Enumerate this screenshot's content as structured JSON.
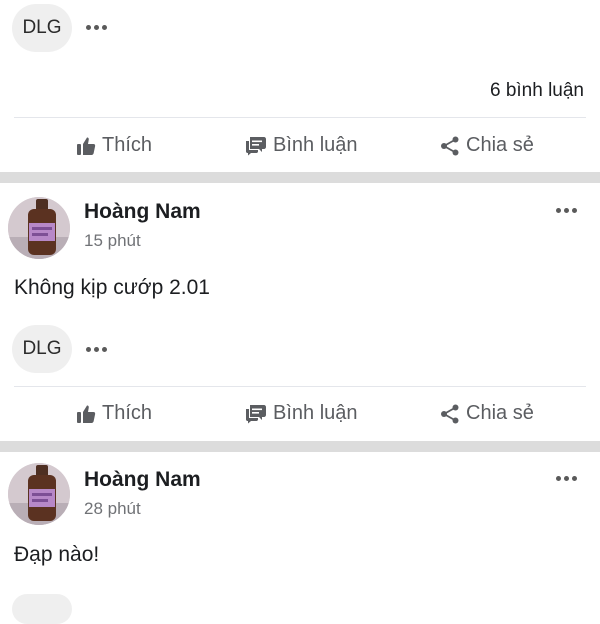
{
  "posts": [
    {
      "reaction_chip": "DLG",
      "comments_count": "6 bình luận",
      "actions": {
        "like": "Thích",
        "comment": "Bình luận",
        "share": "Chia sẻ"
      }
    },
    {
      "author": "Hoàng Nam",
      "time": "15 phút",
      "text": "Không kịp cướp 2.01",
      "reaction_chip": "DLG",
      "actions": {
        "like": "Thích",
        "comment": "Bình luận",
        "share": "Chia sẻ"
      }
    },
    {
      "author": "Hoàng Nam",
      "time": "28 phút",
      "text": "Đạp nào!"
    }
  ],
  "icons": {
    "like": "thumbs-up-icon",
    "comment": "comment-bubble-icon",
    "share": "share-icon",
    "more": "more-horizontal-icon"
  }
}
